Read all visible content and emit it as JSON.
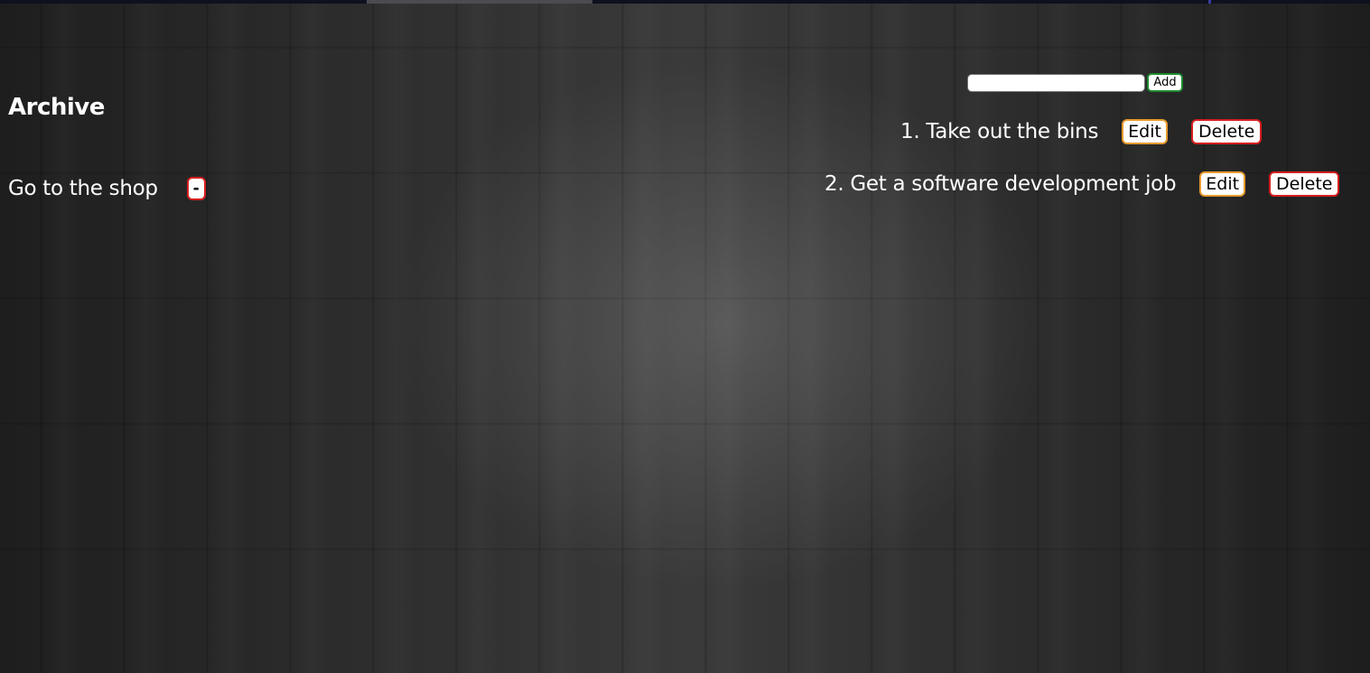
{
  "archive": {
    "title": "Archive",
    "items": [
      {
        "label": "Go to the shop",
        "restore_label": "-"
      }
    ]
  },
  "add_form": {
    "input_value": "",
    "input_placeholder": "",
    "add_label": "Add"
  },
  "todos": [
    {
      "label": "1. Take out the bins",
      "edit_label": "Edit",
      "delete_label": "Delete"
    },
    {
      "label": "2. Get a software development job",
      "edit_label": "Edit",
      "delete_label": "Delete"
    }
  ],
  "colors": {
    "background": "#2a2a2a",
    "text": "#ffffff",
    "add_border": "#1e8a2e",
    "edit_border": "#e59a2e",
    "delete_border": "#d61f1f"
  }
}
